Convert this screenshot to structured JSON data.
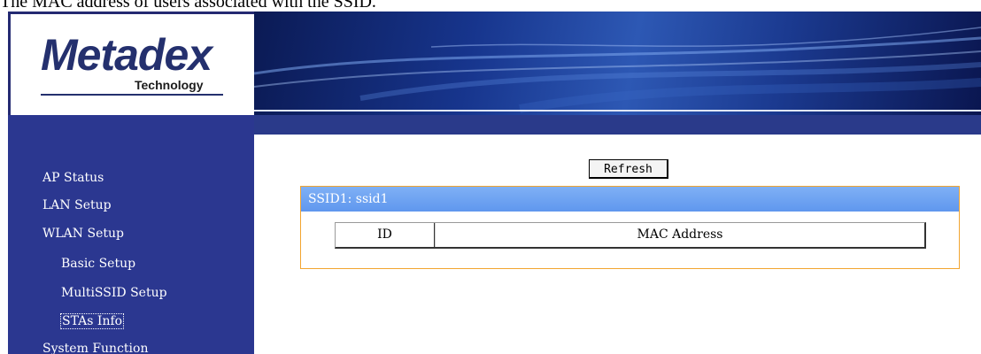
{
  "caption": "The MAC address of users associated with the SSID.",
  "logo": {
    "brand": "Metadex",
    "tagline": "Technology"
  },
  "sidebar": {
    "items": [
      {
        "label": "AP Status"
      },
      {
        "label": "LAN Setup"
      },
      {
        "label": "WLAN Setup"
      },
      {
        "label": "Basic Setup"
      },
      {
        "label": "MultiSSID Setup"
      },
      {
        "label": "STAs Info"
      },
      {
        "label": "System Function"
      }
    ],
    "active_label": "STAs Info"
  },
  "content": {
    "refresh_label": "Refresh",
    "ssid_header": "SSID1: ssid1",
    "table": {
      "columns": [
        "ID",
        "MAC Address"
      ],
      "rows": []
    }
  },
  "colors": {
    "sidebar_bg": "#2b3790",
    "banner_blue": "#17358d",
    "panel_header": "#6a9ff0",
    "panel_border": "#f2a530"
  }
}
